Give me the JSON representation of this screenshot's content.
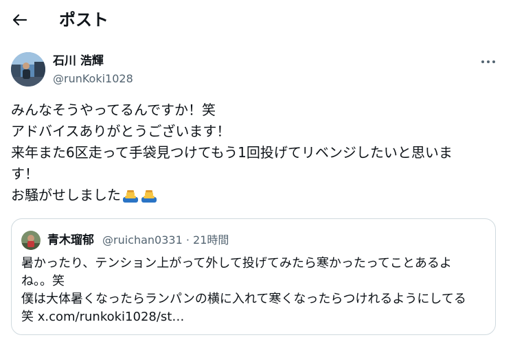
{
  "header": {
    "title": "ポスト",
    "back_icon": "arrow-left-icon"
  },
  "author": {
    "display_name": "石川 浩輝",
    "handle": "@runKoki1028",
    "more_icon": "more-horizontal-icon"
  },
  "tweet": {
    "lines": [
      "みんなそうやってるんですか！笑",
      "アドバイスありがとうございます！",
      "来年また6区走って手袋見つけてもう1回投げてリベンジしたいと思いま",
      "す！",
      "お騒がせしました"
    ],
    "emoji": [
      "bowing-person-emoji",
      "bowing-person-emoji"
    ]
  },
  "quote": {
    "display_name": "青木瑠郁",
    "handle": "@ruichan0331",
    "separator": "·",
    "time": "21時間",
    "lines": [
      "暑かったり、テンション上がって外して投げてみたら寒かったってことあるよ",
      "ね。。笑",
      "僕は大体暑くなったらランパンの横に入れて寒くなったらつけれるようにしてる",
      "笑 x.com/runkoki1028/st…"
    ]
  },
  "colors": {
    "text": "#0f1419",
    "secondary": "#536471",
    "border": "#cfd9de"
  }
}
